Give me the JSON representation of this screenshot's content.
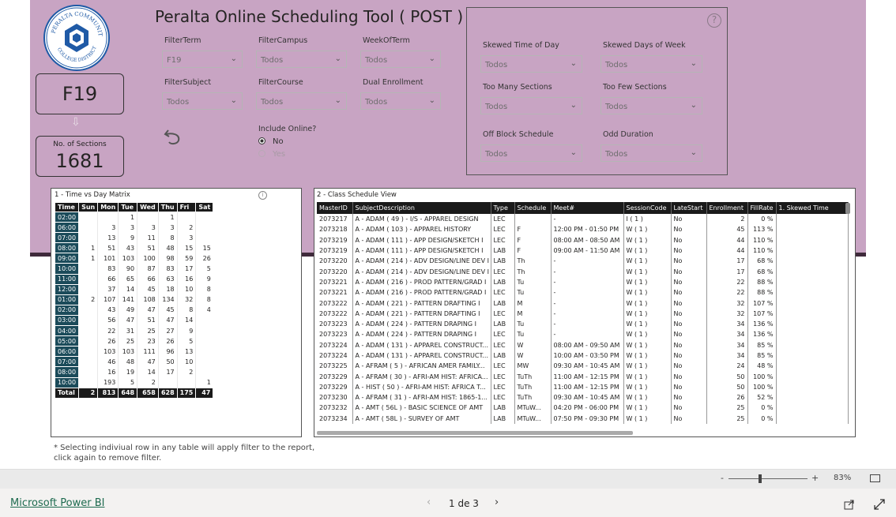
{
  "header": {
    "title": "Peralta Online Scheduling Tool ( POST )"
  },
  "logo": {
    "text_top": "PERALTA COMMUNITY",
    "text_bottom": "COLLEGE DISTRICT"
  },
  "term_card": {
    "value": "F19"
  },
  "sections_card": {
    "label": "No. of Sections",
    "value": "1681"
  },
  "filters": [
    {
      "label": "FilterTerm",
      "value": "F19"
    },
    {
      "label": "FilterCampus",
      "value": "Todos"
    },
    {
      "label": "WeekOfTerm",
      "value": "Todos"
    },
    {
      "label": "FilterSubject",
      "value": "Todos"
    },
    {
      "label": "FilterCourse",
      "value": "Todos"
    },
    {
      "label": "Dual Enrollment",
      "value": "Todos"
    }
  ],
  "online": {
    "label": "Include Online?",
    "options": [
      "No",
      "Yes"
    ],
    "selected": "No"
  },
  "right_filters": [
    {
      "label": "Skewed Time of Day",
      "value": "Todos"
    },
    {
      "label": "Skewed Days of Week",
      "value": "Todos"
    },
    {
      "label": "Too Many Sections",
      "value": "Todos"
    },
    {
      "label": "Too Few Sections",
      "value": "Todos"
    },
    {
      "label": "Off Block Schedule",
      "value": "Todos"
    },
    {
      "label": "Odd Duration",
      "value": "Todos"
    }
  ],
  "matrix": {
    "title": "1 - Time vs Day Matrix",
    "headers": [
      "Time",
      "Sun",
      "Mon",
      "Tue",
      "Wed",
      "Thu",
      "Fri",
      "Sat"
    ],
    "rows": [
      [
        "02:00",
        "",
        "",
        "1",
        "",
        "1",
        "",
        ""
      ],
      [
        "06:00",
        "",
        "3",
        "3",
        "3",
        "3",
        "2",
        ""
      ],
      [
        "07:00",
        "",
        "13",
        "9",
        "11",
        "8",
        "3",
        ""
      ],
      [
        "08:00",
        "1",
        "51",
        "43",
        "51",
        "48",
        "15",
        "15"
      ],
      [
        "09:00",
        "1",
        "101",
        "103",
        "100",
        "98",
        "59",
        "26"
      ],
      [
        "10:00",
        "",
        "83",
        "90",
        "87",
        "83",
        "17",
        "5"
      ],
      [
        "11:00",
        "",
        "66",
        "65",
        "66",
        "63",
        "16",
        "9"
      ],
      [
        "12:00",
        "",
        "37",
        "14",
        "45",
        "18",
        "10",
        "8"
      ],
      [
        "01:00",
        "2",
        "107",
        "141",
        "108",
        "134",
        "32",
        "8"
      ],
      [
        "02:00",
        "",
        "43",
        "49",
        "47",
        "45",
        "8",
        "4"
      ],
      [
        "03:00",
        "",
        "56",
        "47",
        "51",
        "47",
        "14",
        ""
      ],
      [
        "04:00",
        "",
        "22",
        "31",
        "25",
        "27",
        "9",
        ""
      ],
      [
        "05:00",
        "",
        "26",
        "25",
        "23",
        "26",
        "5",
        ""
      ],
      [
        "06:00",
        "",
        "103",
        "103",
        "111",
        "96",
        "13",
        ""
      ],
      [
        "07:00",
        "",
        "46",
        "48",
        "47",
        "50",
        "10",
        ""
      ],
      [
        "08:00",
        "",
        "16",
        "19",
        "14",
        "17",
        "2",
        ""
      ],
      [
        "10:00",
        "",
        "193",
        "5",
        "2",
        "",
        "",
        "1"
      ]
    ],
    "total": [
      "Total",
      "2",
      "813",
      "648",
      "658",
      "628",
      "175",
      "47"
    ]
  },
  "schedule": {
    "title": "2 - Class Schedule View",
    "headers": [
      "MasterID",
      "SubjectDescription",
      "Type",
      "Schedule",
      "Meet#",
      "SessionCode",
      "LateStart",
      "Enrollment",
      "FillRate",
      "1. Skewed Time"
    ],
    "rows": [
      [
        "2073217",
        "A - ADAM ( 49 ) - I/S - APPAREL DESIGN",
        "LEC",
        "",
        "-",
        "I ( 1 )",
        "No",
        "2",
        "0 %",
        ""
      ],
      [
        "2073218",
        "A - ADAM ( 103 ) - APPAREL HISTORY",
        "LEC",
        "F",
        "12:00 PM - 01:50 PM",
        "W ( 1 )",
        "No",
        "45",
        "113 %",
        ""
      ],
      [
        "2073219",
        "A - ADAM ( 111 ) - APP DESIGN/SKETCH I",
        "LEC",
        "F",
        "08:00 AM - 08:50 AM",
        "W ( 1 )",
        "No",
        "44",
        "110 %",
        ""
      ],
      [
        "2073219",
        "A - ADAM ( 111 ) - APP DESIGN/SKETCH I",
        "LAB",
        "F",
        "09:00 AM - 11:50 AM",
        "W ( 1 )",
        "No",
        "44",
        "110 %",
        ""
      ],
      [
        "2073220",
        "A - ADAM ( 214 ) - ADV DESIGN/LINE DEV I",
        "LAB",
        "Th",
        "-",
        "W ( 1 )",
        "No",
        "17",
        "68 %",
        ""
      ],
      [
        "2073220",
        "A - ADAM ( 214 ) - ADV DESIGN/LINE DEV I",
        "LEC",
        "Th",
        "-",
        "W ( 1 )",
        "No",
        "17",
        "68 %",
        ""
      ],
      [
        "2073221",
        "A - ADAM ( 216 ) - PROD PATTERN/GRAD I",
        "LAB",
        "Tu",
        "-",
        "W ( 1 )",
        "No",
        "22",
        "88 %",
        ""
      ],
      [
        "2073221",
        "A - ADAM ( 216 ) - PROD PATTERN/GRAD I",
        "LEC",
        "Tu",
        "-",
        "W ( 1 )",
        "No",
        "22",
        "88 %",
        ""
      ],
      [
        "2073222",
        "A - ADAM ( 221 ) - PATTERN DRAFTING I",
        "LAB",
        "M",
        "-",
        "W ( 1 )",
        "No",
        "32",
        "107 %",
        ""
      ],
      [
        "2073222",
        "A - ADAM ( 221 ) - PATTERN DRAFTING I",
        "LEC",
        "M",
        "-",
        "W ( 1 )",
        "No",
        "32",
        "107 %",
        ""
      ],
      [
        "2073223",
        "A - ADAM ( 224 ) - PATTERN DRAPING I",
        "LAB",
        "Tu",
        "-",
        "W ( 1 )",
        "No",
        "34",
        "136 %",
        ""
      ],
      [
        "2073223",
        "A - ADAM ( 224 ) - PATTERN DRAPING I",
        "LEC",
        "Tu",
        "-",
        "W ( 1 )",
        "No",
        "34",
        "136 %",
        ""
      ],
      [
        "2073224",
        "A - ADAM ( 131 ) - APPAREL CONSTRUCT...",
        "LEC",
        "W",
        "08:00 AM - 09:50 AM",
        "W ( 1 )",
        "No",
        "34",
        "85 %",
        ""
      ],
      [
        "2073224",
        "A - ADAM ( 131 ) - APPAREL CONSTRUCT...",
        "LAB",
        "W",
        "10:00 AM - 03:50 PM",
        "W ( 1 )",
        "No",
        "34",
        "85 %",
        ""
      ],
      [
        "2073225",
        "A - AFRAM ( 5 ) - AFRICAN AMER FAMILY...",
        "LEC",
        "MW",
        "09:30 AM - 10:45 AM",
        "W ( 1 )",
        "No",
        "24",
        "48 %",
        ""
      ],
      [
        "2073229",
        "A - AFRAM ( 30 ) - AFRI-AM HIST: AFRICA...",
        "LEC",
        "TuTh",
        "11:00 AM - 12:15 PM",
        "W ( 1 )",
        "No",
        "50",
        "100 %",
        ""
      ],
      [
        "2073229",
        "A - HIST ( 50 ) - AFRI-AM HIST: AFRICA T...",
        "LEC",
        "TuTh",
        "11:00 AM - 12:15 PM",
        "W ( 1 )",
        "No",
        "50",
        "100 %",
        ""
      ],
      [
        "2073230",
        "A - AFRAM ( 31 ) - AFRI-AM HIST: 1865-1...",
        "LEC",
        "TuTh",
        "09:30 AM - 10:45 AM",
        "W ( 1 )",
        "No",
        "26",
        "52 %",
        ""
      ],
      [
        "2073232",
        "A - AMT ( 56L ) - BASIC SCIENCE OF AMT",
        "LAB",
        "MTuW...",
        "04:20 PM - 06:00 PM",
        "W ( 1 )",
        "No",
        "25",
        "0 %",
        ""
      ],
      [
        "2073234",
        "A - AMT ( 58L ) - SURVEY OF AMT",
        "LAB",
        "MTuW...",
        "07:50 PM - 09:30 PM",
        "W ( 1 )",
        "No",
        "25",
        "0 %",
        ""
      ]
    ]
  },
  "note": "* Selecting indiviual row in any table will apply filter to the report, click again to remove filter.",
  "zoom": {
    "minus": "-",
    "plus": "+",
    "value": "83%"
  },
  "footer": {
    "brand": "Microsoft Power BI",
    "page": "1 de 3"
  }
}
